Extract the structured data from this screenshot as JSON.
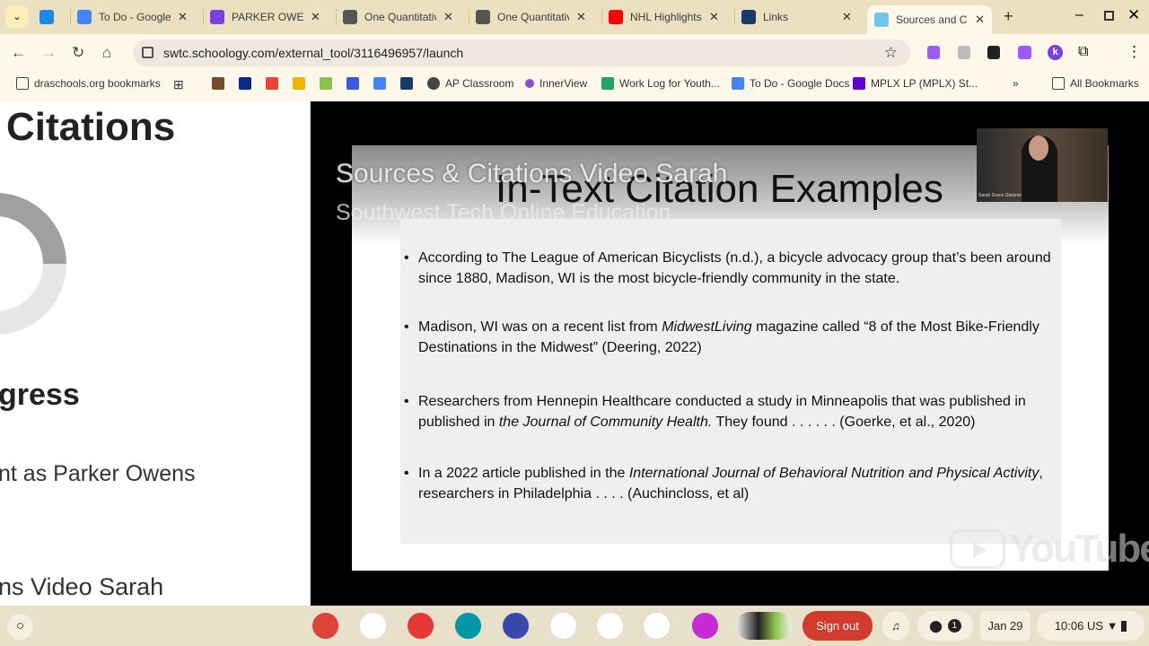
{
  "browser": {
    "tabs": [
      {
        "title": "",
        "icon": "dropbox-paper-icon",
        "color": "#1e88e5"
      },
      {
        "title": "To Do - Google Docs",
        "icon": "google-docs-icon",
        "color": "#4285f4"
      },
      {
        "title": "PARKER OWENS",
        "icon": "k-icon",
        "color": "#7b3fe4"
      },
      {
        "title": "One Quantitative",
        "icon": "globe-icon",
        "color": "#555555"
      },
      {
        "title": "One Quantitative",
        "icon": "globe-icon",
        "color": "#555555"
      },
      {
        "title": "NHL Highlights",
        "icon": "youtube-icon",
        "color": "#ff0000"
      },
      {
        "title": "Links",
        "icon": "clipboard-icon",
        "color": "#1a3a6b"
      },
      {
        "title": "Sources and Citations",
        "icon": "p-icon",
        "color": "#6ec6e8",
        "active": true
      }
    ],
    "url": "swtc.schoology.com/external_tool/3116496957/launch",
    "bookmarks": [
      {
        "label": "draschools.org bookmarks"
      },
      {
        "label": "AP Classroom"
      },
      {
        "label": "InnerView"
      },
      {
        "label": "Work Log for Youth..."
      },
      {
        "label": "To Do - Google Docs"
      },
      {
        "label": "MPLX LP (MPLX) St..."
      }
    ],
    "all_bookmarks": "All Bookmarks"
  },
  "left_panel": {
    "title": "Citations",
    "progress_heading": "gress",
    "student_text": "nt as Parker Owens",
    "item_text": "ns Video Sarah",
    "progress_fraction": 0.25
  },
  "video": {
    "overlay_title": "Sources & Citations Video Sarah",
    "overlay_channel": "Southwest Tech Online Education",
    "slide_title": "In-Text Citation Examples",
    "webcam_name": "Sarah Grace Gleisner",
    "watermark": "YouTube",
    "bullets": [
      {
        "parts": [
          {
            "t": "According to The League of American Bicyclists (n.d.), a bicycle advocacy group that’s been around since 1880, Madison, WI is the most bicycle-friendly community in the state."
          }
        ]
      },
      {
        "parts": [
          {
            "t": "Madison, WI was on a recent list from "
          },
          {
            "t": "MidwestLiving",
            "i": true
          },
          {
            "t": " magazine called “8 of the Most Bike-Friendly Destinations in the Midwest” (Deering, 2022)"
          }
        ]
      },
      {
        "parts": [
          {
            "t": "Researchers from Hennepin Healthcare conducted a study in Minneapolis that was published in published in "
          },
          {
            "t": "the Journal of Community Health.",
            "i": true
          },
          {
            "t": " They found . . . . . . (Goerke, et al., 2020)"
          }
        ]
      },
      {
        "parts": [
          {
            "t": "In a 2022 article published in the "
          },
          {
            "t": "International Journal of Behavioral Nutrition and Physical Activity",
            "i": true
          },
          {
            "t": ", researchers in Philadelphia . . . . (Auchincloss, et al)"
          }
        ]
      }
    ]
  },
  "taskbar": {
    "sign_out": "Sign out",
    "notifications": "1",
    "date": "Jan 29",
    "time": "10:06",
    "locale": "US"
  }
}
